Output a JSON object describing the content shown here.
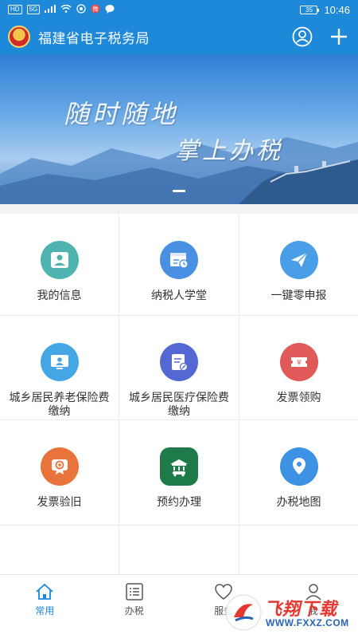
{
  "status_bar": {
    "network_chips": [
      "HD",
      "5G"
    ],
    "battery": "35",
    "time": "10:46"
  },
  "app": {
    "title": "福建省电子税务局",
    "actions": [
      "user-icon",
      "plus-icon"
    ]
  },
  "banner": {
    "line1": "随时随地",
    "line2": "掌上办税",
    "slide_count": 1,
    "active_slide": 1
  },
  "services": [
    {
      "label": "我的信息",
      "icon": "person-card-icon",
      "color": "#4fb3b0"
    },
    {
      "label": "纳税人学堂",
      "icon": "calendar-clock-icon",
      "color": "#4a90e2"
    },
    {
      "label": "一键零申报",
      "icon": "paper-plane-icon",
      "color": "#4a9ee8"
    },
    {
      "label": "城乡居民养老保险费缴纳",
      "icon": "monitor-person-icon",
      "color": "#45a6e6"
    },
    {
      "label": "城乡居民医疗保险费缴纳",
      "icon": "document-edit-icon",
      "color": "#5468d4"
    },
    {
      "label": "发票领购",
      "icon": "ticket-yen-icon",
      "color": "#e05a5a"
    },
    {
      "label": "发票验旧",
      "icon": "seal-stamp-icon",
      "color": "#e8743b"
    },
    {
      "label": "预约办理",
      "icon": "building-car-icon",
      "color": "#1f7a4a"
    },
    {
      "label": "办税地图",
      "icon": "map-pin-icon",
      "color": "#3d92e3"
    }
  ],
  "bottom_nav": [
    {
      "label": "常用",
      "icon": "home-icon",
      "active": true
    },
    {
      "label": "办税",
      "icon": "list-icon",
      "active": false
    },
    {
      "label": "服务",
      "icon": "heart-icon",
      "active": false
    },
    {
      "label": "我",
      "icon": "person-icon",
      "active": false
    }
  ],
  "watermark": {
    "text": "飞翔下载",
    "url": "WWW.FXXZ.COM"
  },
  "colors": {
    "brand": "#1e88d9",
    "accent_active": "#1e88d9"
  }
}
